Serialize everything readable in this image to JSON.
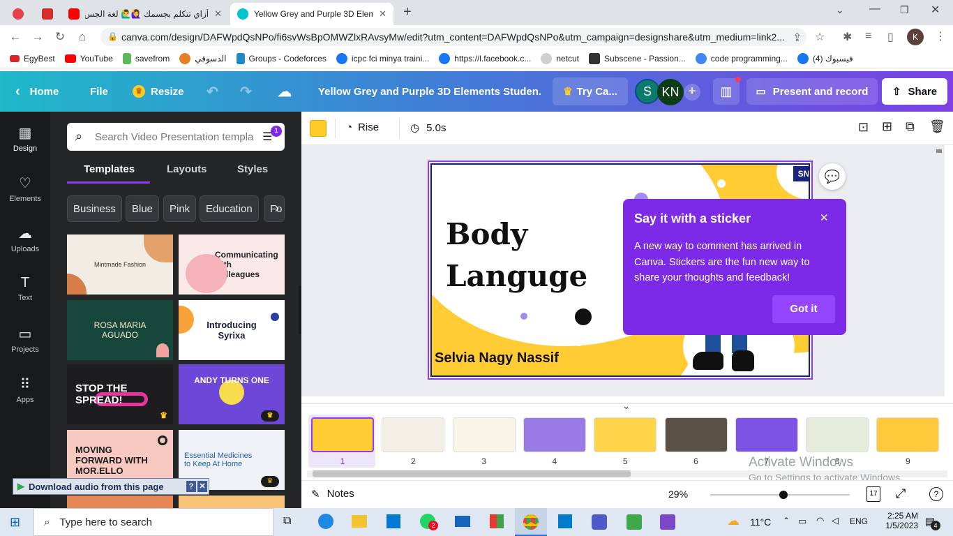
{
  "browser": {
    "tabs": [
      {
        "label": "",
        "favicon_color": "#e8404a"
      },
      {
        "label": "",
        "favicon_color": "#d32f2f"
      },
      {
        "label": "أزاي تتكلم بجسمك 🙋‍♀️🙋‍♂️ لغة الجس",
        "favicon_color": "#ff0000"
      },
      {
        "label": "Yellow Grey and Purple 3D Eleme",
        "favicon_color": "#00c4cc"
      }
    ],
    "url": "canva.com/design/DAFWpdQsNPo/fi6svWsBpOMWZlxRAvsyMw/edit?utm_content=DAFWpdQsNPo&utm_campaign=designshare&utm_medium=link2...",
    "profile_initial": "K",
    "bookmarks": [
      {
        "label": "EgyBest",
        "color": "#d62828"
      },
      {
        "label": "YouTube",
        "color": "#ff0000"
      },
      {
        "label": "savefrom",
        "color": "#5cb85c"
      },
      {
        "label": "الدسوقي",
        "color": "#e67e22"
      },
      {
        "label": "Groups - Codeforces",
        "color": "#1f8acb"
      },
      {
        "label": "icpc fci minya traini...",
        "color": "#1877f2"
      },
      {
        "label": "https://l.facebook.c...",
        "color": "#1877f2"
      },
      {
        "label": "netcut",
        "color": "#bbbbbb"
      },
      {
        "label": "Subscene - Passion...",
        "color": "#333333"
      },
      {
        "label": "code programming...",
        "color": "#4285f4"
      },
      {
        "label": "فيسبوك (4)",
        "color": "#1877f2"
      }
    ]
  },
  "header": {
    "home": "Home",
    "file": "File",
    "resize": "Resize",
    "title": "Yellow Grey and Purple 3D Elements Studen...",
    "try": "Try Ca...",
    "avatar1": "S",
    "avatar2": "KN",
    "present": "Present and record",
    "share": "Share"
  },
  "rail": [
    "Design",
    "Elements",
    "Uploads",
    "Text",
    "Projects",
    "Apps"
  ],
  "panel": {
    "search_placeholder": "Search Video Presentation templa",
    "filter_badge": "1",
    "tabs": [
      "Templates",
      "Layouts",
      "Styles"
    ],
    "chips": [
      "Business",
      "Blue",
      "Pink",
      "Education",
      "Fo"
    ],
    "templates": [
      {
        "title": "Mintmade Fashion",
        "bg": "#f3ece4",
        "fg": "#333333"
      },
      {
        "title": "Communicating with Colleagues",
        "bg": "#fbe9ea",
        "fg": "#222222"
      },
      {
        "title": "ROSA MARIA AGUADO",
        "bg": "#17473a",
        "fg": "#f2e6c9"
      },
      {
        "title": "Introducing Syrixa",
        "bg": "#ffffff",
        "fg": "#1b1f3b"
      },
      {
        "title": "STOP THE SPREAD!",
        "bg": "#1d1d1f",
        "fg": "#ffffff"
      },
      {
        "title": "ANDY TURNS ONE",
        "bg": "#6c47d8",
        "fg": "#ffffff"
      },
      {
        "title": "MOVING FORWARD WITH MOR.ELLO",
        "bg": "#f8c9c0",
        "fg": "#1b1b1b"
      },
      {
        "title": "Essential Medicines to Keep At Home",
        "bg": "#eef2f7",
        "fg": "#2363a8"
      }
    ]
  },
  "toolbar": {
    "animation": "Rise",
    "duration": "5.0s",
    "color": "#ffc928"
  },
  "slide": {
    "title_line1": "Body",
    "title_line2": "Languge",
    "author": "Selvia Nagy Nassif",
    "badge": "SN"
  },
  "popover": {
    "title": "Say it with a sticker",
    "body": "A new way to comment has arrived in Canva. Stickers are the fun new way to share your thoughts and feedback!",
    "button": "Got it"
  },
  "pages": [
    "1",
    "2",
    "3",
    "4",
    "5",
    "6",
    "7",
    "8",
    "9"
  ],
  "footer": {
    "notes": "Notes",
    "zoom": "29%",
    "page_count": "17",
    "zoom_level": 0.29
  },
  "watermark": {
    "line1": "Activate Windows",
    "line2": "Go to Settings to activate Windows."
  },
  "download_bar": "Download audio from this page",
  "taskbar": {
    "search": "Type here to search",
    "weather": "11°C",
    "lang": "ENG",
    "time": "2:25 AM",
    "date": "1/5/2023",
    "notifications": "4",
    "whatsapp_badge": "2"
  }
}
